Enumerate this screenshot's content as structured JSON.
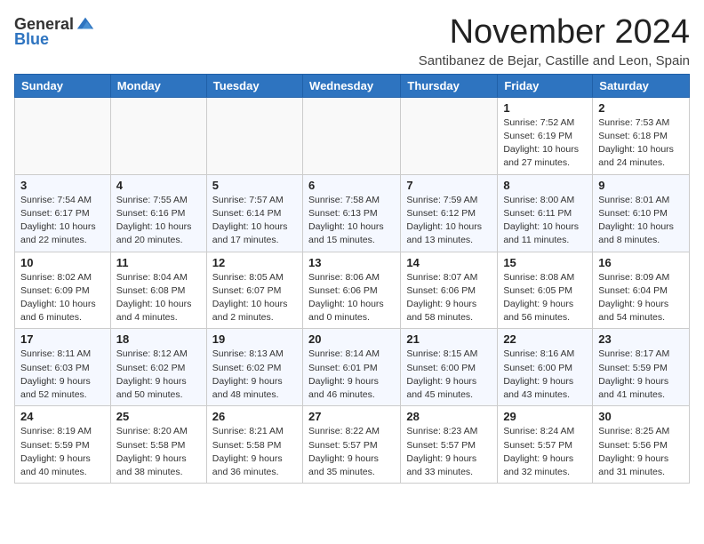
{
  "header": {
    "logo_line1": "General",
    "logo_line2": "Blue",
    "month": "November 2024",
    "location": "Santibanez de Bejar, Castille and Leon, Spain"
  },
  "weekdays": [
    "Sunday",
    "Monday",
    "Tuesday",
    "Wednesday",
    "Thursday",
    "Friday",
    "Saturday"
  ],
  "weeks": [
    [
      {
        "day": "",
        "info": ""
      },
      {
        "day": "",
        "info": ""
      },
      {
        "day": "",
        "info": ""
      },
      {
        "day": "",
        "info": ""
      },
      {
        "day": "",
        "info": ""
      },
      {
        "day": "1",
        "info": "Sunrise: 7:52 AM\nSunset: 6:19 PM\nDaylight: 10 hours\nand 27 minutes."
      },
      {
        "day": "2",
        "info": "Sunrise: 7:53 AM\nSunset: 6:18 PM\nDaylight: 10 hours\nand 24 minutes."
      }
    ],
    [
      {
        "day": "3",
        "info": "Sunrise: 7:54 AM\nSunset: 6:17 PM\nDaylight: 10 hours\nand 22 minutes."
      },
      {
        "day": "4",
        "info": "Sunrise: 7:55 AM\nSunset: 6:16 PM\nDaylight: 10 hours\nand 20 minutes."
      },
      {
        "day": "5",
        "info": "Sunrise: 7:57 AM\nSunset: 6:14 PM\nDaylight: 10 hours\nand 17 minutes."
      },
      {
        "day": "6",
        "info": "Sunrise: 7:58 AM\nSunset: 6:13 PM\nDaylight: 10 hours\nand 15 minutes."
      },
      {
        "day": "7",
        "info": "Sunrise: 7:59 AM\nSunset: 6:12 PM\nDaylight: 10 hours\nand 13 minutes."
      },
      {
        "day": "8",
        "info": "Sunrise: 8:00 AM\nSunset: 6:11 PM\nDaylight: 10 hours\nand 11 minutes."
      },
      {
        "day": "9",
        "info": "Sunrise: 8:01 AM\nSunset: 6:10 PM\nDaylight: 10 hours\nand 8 minutes."
      }
    ],
    [
      {
        "day": "10",
        "info": "Sunrise: 8:02 AM\nSunset: 6:09 PM\nDaylight: 10 hours\nand 6 minutes."
      },
      {
        "day": "11",
        "info": "Sunrise: 8:04 AM\nSunset: 6:08 PM\nDaylight: 10 hours\nand 4 minutes."
      },
      {
        "day": "12",
        "info": "Sunrise: 8:05 AM\nSunset: 6:07 PM\nDaylight: 10 hours\nand 2 minutes."
      },
      {
        "day": "13",
        "info": "Sunrise: 8:06 AM\nSunset: 6:06 PM\nDaylight: 10 hours\nand 0 minutes."
      },
      {
        "day": "14",
        "info": "Sunrise: 8:07 AM\nSunset: 6:06 PM\nDaylight: 9 hours\nand 58 minutes."
      },
      {
        "day": "15",
        "info": "Sunrise: 8:08 AM\nSunset: 6:05 PM\nDaylight: 9 hours\nand 56 minutes."
      },
      {
        "day": "16",
        "info": "Sunrise: 8:09 AM\nSunset: 6:04 PM\nDaylight: 9 hours\nand 54 minutes."
      }
    ],
    [
      {
        "day": "17",
        "info": "Sunrise: 8:11 AM\nSunset: 6:03 PM\nDaylight: 9 hours\nand 52 minutes."
      },
      {
        "day": "18",
        "info": "Sunrise: 8:12 AM\nSunset: 6:02 PM\nDaylight: 9 hours\nand 50 minutes."
      },
      {
        "day": "19",
        "info": "Sunrise: 8:13 AM\nSunset: 6:02 PM\nDaylight: 9 hours\nand 48 minutes."
      },
      {
        "day": "20",
        "info": "Sunrise: 8:14 AM\nSunset: 6:01 PM\nDaylight: 9 hours\nand 46 minutes."
      },
      {
        "day": "21",
        "info": "Sunrise: 8:15 AM\nSunset: 6:00 PM\nDaylight: 9 hours\nand 45 minutes."
      },
      {
        "day": "22",
        "info": "Sunrise: 8:16 AM\nSunset: 6:00 PM\nDaylight: 9 hours\nand 43 minutes."
      },
      {
        "day": "23",
        "info": "Sunrise: 8:17 AM\nSunset: 5:59 PM\nDaylight: 9 hours\nand 41 minutes."
      }
    ],
    [
      {
        "day": "24",
        "info": "Sunrise: 8:19 AM\nSunset: 5:59 PM\nDaylight: 9 hours\nand 40 minutes."
      },
      {
        "day": "25",
        "info": "Sunrise: 8:20 AM\nSunset: 5:58 PM\nDaylight: 9 hours\nand 38 minutes."
      },
      {
        "day": "26",
        "info": "Sunrise: 8:21 AM\nSunset: 5:58 PM\nDaylight: 9 hours\nand 36 minutes."
      },
      {
        "day": "27",
        "info": "Sunrise: 8:22 AM\nSunset: 5:57 PM\nDaylight: 9 hours\nand 35 minutes."
      },
      {
        "day": "28",
        "info": "Sunrise: 8:23 AM\nSunset: 5:57 PM\nDaylight: 9 hours\nand 33 minutes."
      },
      {
        "day": "29",
        "info": "Sunrise: 8:24 AM\nSunset: 5:57 PM\nDaylight: 9 hours\nand 32 minutes."
      },
      {
        "day": "30",
        "info": "Sunrise: 8:25 AM\nSunset: 5:56 PM\nDaylight: 9 hours\nand 31 minutes."
      }
    ]
  ]
}
